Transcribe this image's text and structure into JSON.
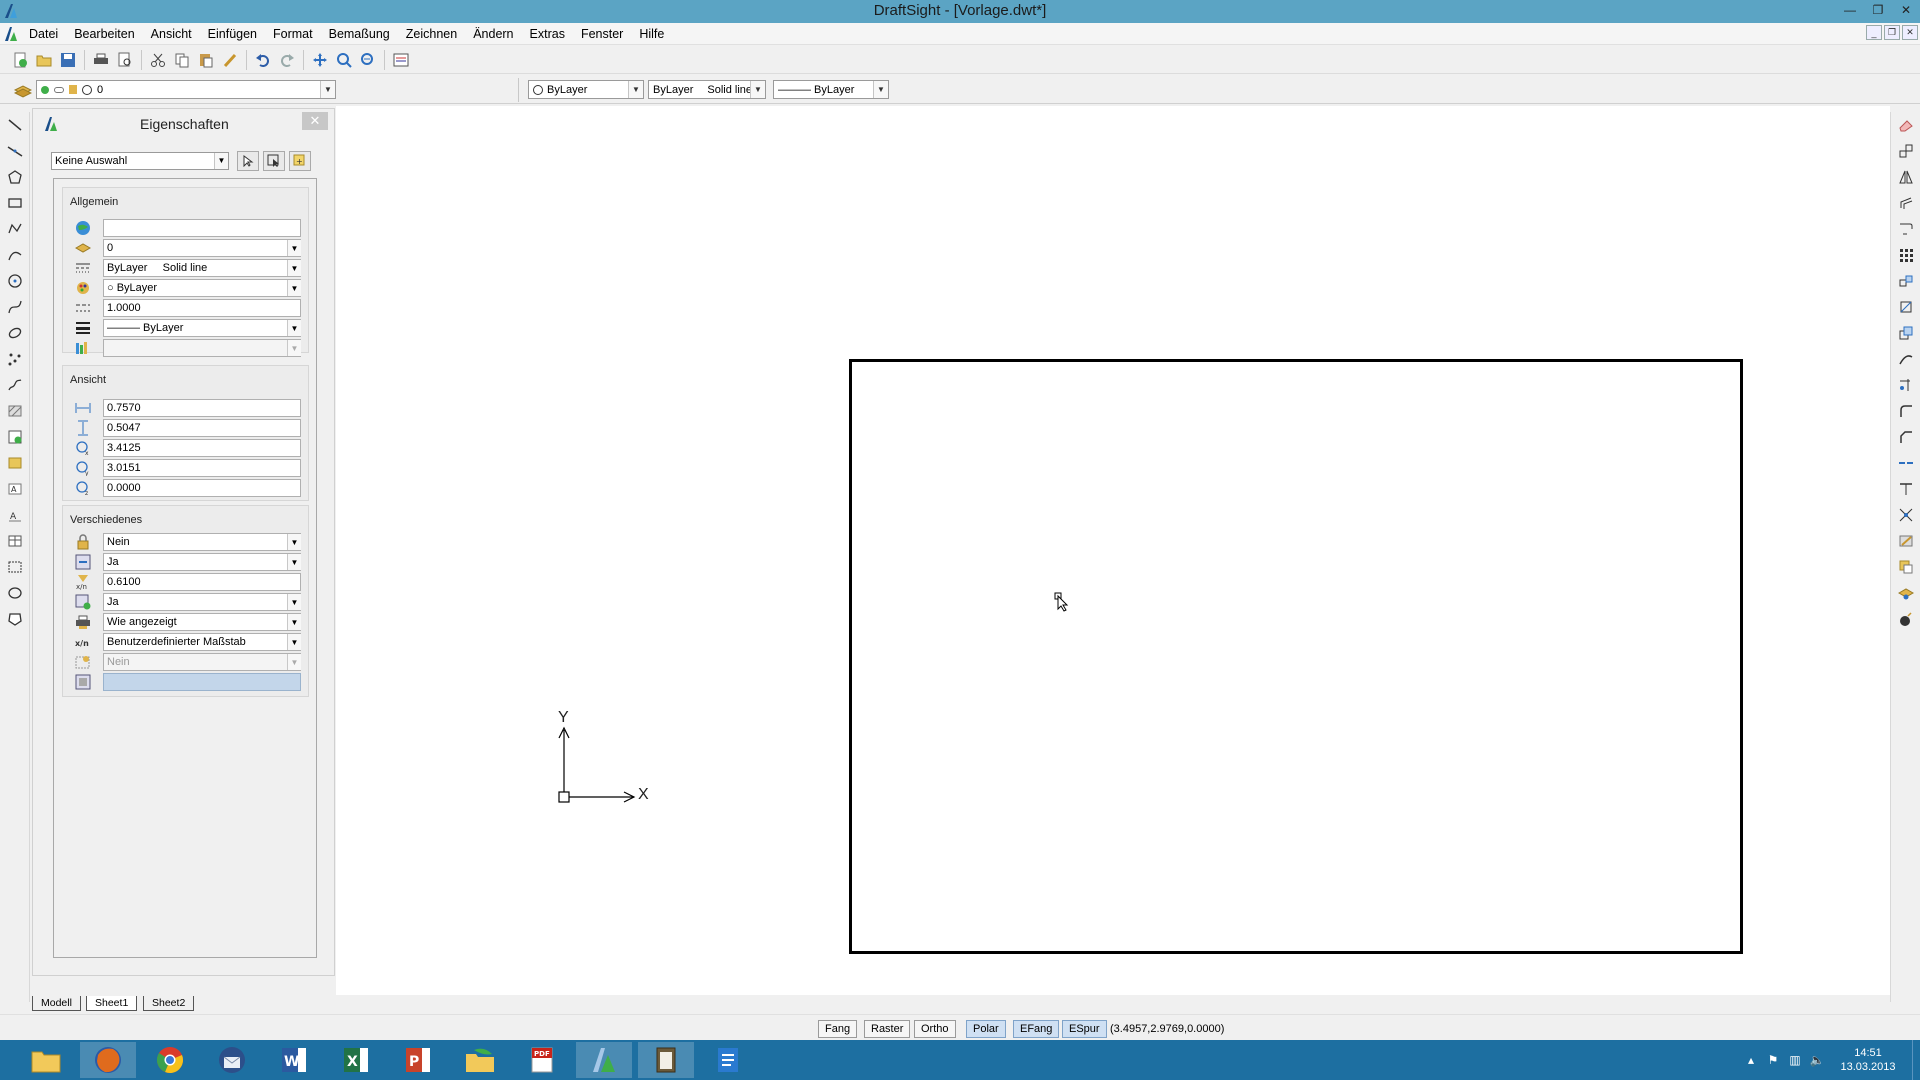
{
  "window": {
    "title": "DraftSight - [Vorlage.dwt*]"
  },
  "menu": [
    "Datei",
    "Bearbeiten",
    "Ansicht",
    "Einfügen",
    "Format",
    "Bemaßung",
    "Zeichnen",
    "Ändern",
    "Extras",
    "Fenster",
    "Hilfe"
  ],
  "layer_toolbar": {
    "layer_value": "0",
    "color_value": "ByLayer",
    "linestyle_value": "ByLayer",
    "linestyle_name": "Solid line",
    "lineweight_value": "——— ByLayer"
  },
  "properties": {
    "title": "Eigenschaften",
    "selection": "Keine Auswahl",
    "groups": {
      "general": {
        "title": "Allgemein",
        "rows": [
          "",
          "0",
          "ByLayer     Solid line",
          "○ ByLayer",
          "1.0000",
          "——— ByLayer",
          ""
        ]
      },
      "view": {
        "title": "Ansicht",
        "rows": [
          "0.7570",
          "0.5047",
          "3.4125",
          "3.0151",
          "0.0000"
        ]
      },
      "misc": {
        "title": "Verschiedenes",
        "rows": [
          "Nein",
          "Ja",
          "0.6100",
          "Ja",
          "Wie angezeigt",
          "Benutzerdefinierter Maßstab",
          "Nein",
          ""
        ]
      }
    }
  },
  "canvas": {
    "ucs_x": "X",
    "ucs_y": "Y"
  },
  "layout_tabs": [
    "Modell",
    "Sheet1",
    "Sheet2"
  ],
  "active_tab": "Sheet1",
  "status": {
    "toggles": [
      "Fang",
      "Raster",
      "Ortho",
      "Polar",
      "EFang",
      "ESpur"
    ],
    "active_toggles": [
      "Polar",
      "EFang",
      "ESpur"
    ],
    "coordinates": "(3.4957,2.9769,0.0000)"
  },
  "taskbar": {
    "apps": [
      "file-explorer",
      "firefox",
      "chrome",
      "thunderbird",
      "word",
      "excel",
      "powerpoint",
      "photos",
      "acrobat",
      "draftsight",
      "notes",
      "writer"
    ],
    "time": "14:51",
    "date": "13.03.2013"
  },
  "colors": {
    "titlebar": "#5ba4c4",
    "taskbar": "#1d6fa1",
    "status_active": "#cfe0f3"
  }
}
